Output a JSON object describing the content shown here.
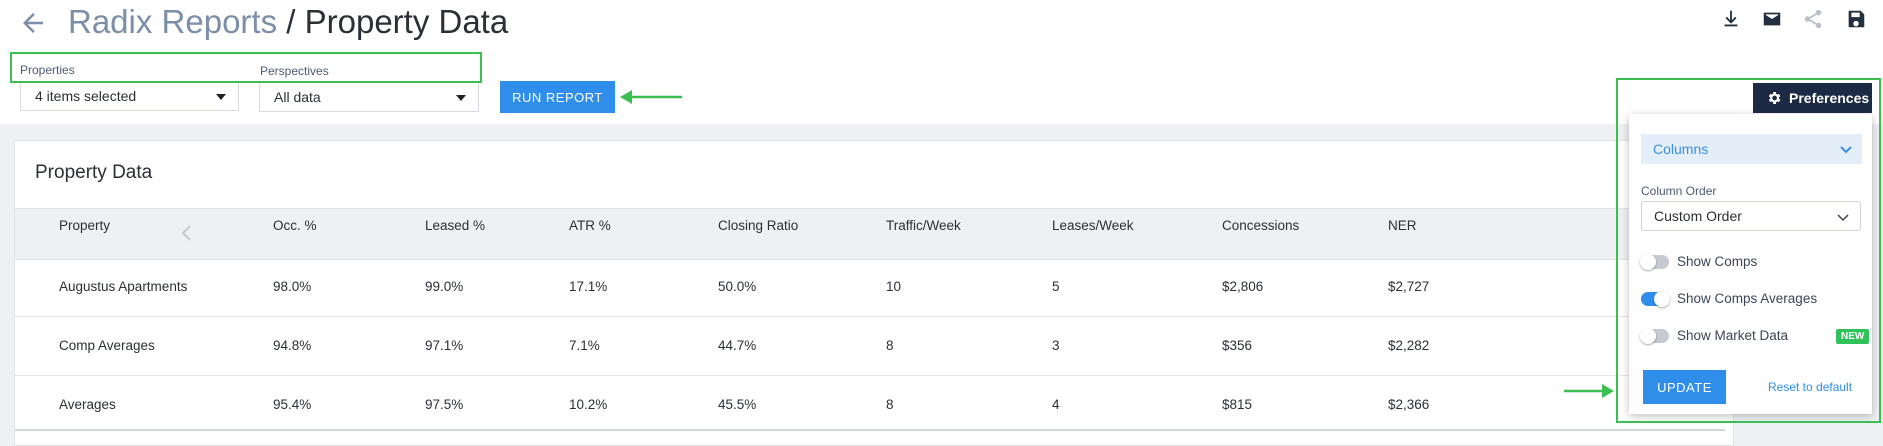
{
  "header": {
    "breadcrumb_parent": "Radix Reports",
    "separator": "/",
    "title": "Property Data"
  },
  "toolbar": {
    "icons": [
      "download-icon",
      "email-icon",
      "share-icon",
      "save-icon"
    ]
  },
  "filters": {
    "properties_label": "Properties",
    "properties_value": "4 items selected",
    "perspectives_label": "Perspectives",
    "perspectives_value": "All data",
    "run_report_label": "RUN REPORT"
  },
  "card": {
    "title": "Property Data"
  },
  "table": {
    "columns": [
      "Property",
      "Occ. %",
      "Leased %",
      "ATR %",
      "Closing Ratio",
      "Traffic/Week",
      "Leases/Week",
      "Concessions",
      "NER"
    ],
    "rows": [
      [
        "Augustus Apartments",
        "98.0%",
        "99.0%",
        "17.1%",
        "50.0%",
        "10",
        "5",
        "$2,806",
        "$2,727"
      ],
      [
        "Comp Averages",
        "94.8%",
        "97.1%",
        "7.1%",
        "44.7%",
        "8",
        "3",
        "$356",
        "$2,282"
      ],
      [
        "Averages",
        "95.4%",
        "97.5%",
        "10.2%",
        "45.5%",
        "8",
        "4",
        "$815",
        "$2,366"
      ]
    ]
  },
  "preferences": {
    "button_label": "Preferences",
    "columns_label": "Columns",
    "column_order_label": "Column Order",
    "column_order_value": "Custom Order",
    "toggles": [
      {
        "label": "Show Comps",
        "on": false
      },
      {
        "label": "Show Comps Averages",
        "on": true
      },
      {
        "label": "Show Market Data",
        "on": false,
        "badge": "NEW"
      }
    ],
    "update_label": "UPDATE",
    "reset_label": "Reset to default"
  },
  "colors": {
    "accent_blue": "#2f8eea",
    "nav_dark": "#1d2a44",
    "annotation_green": "#3cbf52",
    "badge_green": "#2fc25b"
  }
}
